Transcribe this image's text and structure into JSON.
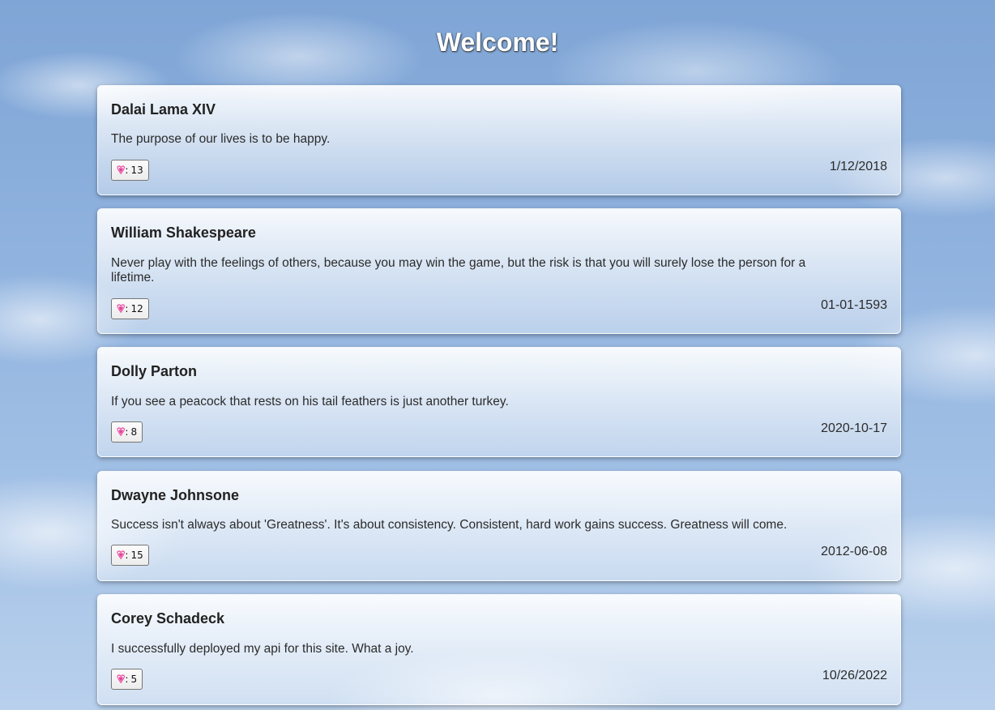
{
  "page": {
    "title": "Welcome!"
  },
  "quotes": [
    {
      "author": "Dalai Lama XIV",
      "text": "The purpose of our lives is to be happy.",
      "likes": "13",
      "date": "1/12/2018"
    },
    {
      "author": "William Shakespeare",
      "text": "Never play with the feelings of others, because you may win the game, but the risk is that you will surely lose the person for a lifetime.",
      "likes": "12",
      "date": "01-01-1593"
    },
    {
      "author": "Dolly Parton",
      "text": "If you see a peacock that rests on his tail feathers is just another turkey.",
      "likes": "8",
      "date": "2020-10-17"
    },
    {
      "author": "Dwayne Johnsone",
      "text": "Success isn't always about 'Greatness'. It's about consistency. Consistent, hard work gains success. Greatness will come.",
      "likes": "15",
      "date": "2012-06-08"
    },
    {
      "author": "Corey Schadeck",
      "text": "I successfully deployed my api for this site. What a joy.",
      "likes": "5",
      "date": "10/26/2022"
    }
  ],
  "like_button": {
    "icon": "heart-icon",
    "separator": ":"
  },
  "colors": {
    "heart": "#e3409a"
  }
}
